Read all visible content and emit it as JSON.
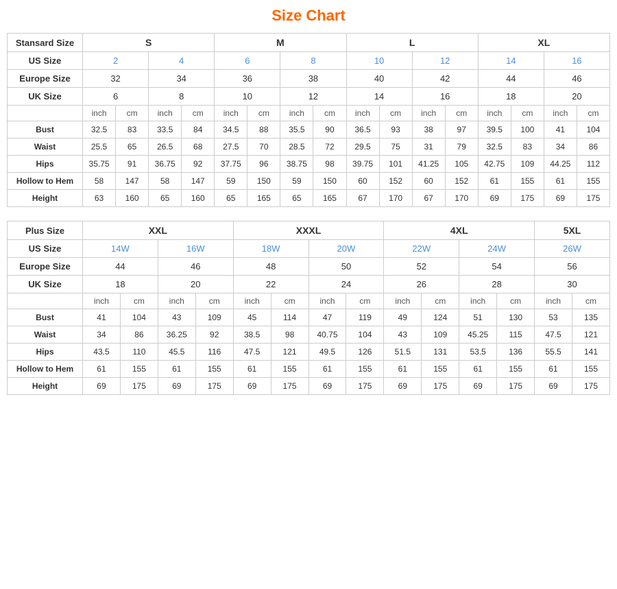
{
  "title": "Size Chart",
  "standard": {
    "header_label": "Stansard Size",
    "size_groups": [
      {
        "label": "S",
        "colspan": 4
      },
      {
        "label": "M",
        "colspan": 4
      },
      {
        "label": "L",
        "colspan": 4
      },
      {
        "label": "XL",
        "colspan": 4
      }
    ],
    "us_size_label": "US Size",
    "us_sizes": [
      "2",
      "4",
      "6",
      "8",
      "10",
      "12",
      "14",
      "16"
    ],
    "europe_size_label": "Europe Size",
    "europe_sizes": [
      "32",
      "34",
      "36",
      "38",
      "40",
      "42",
      "44",
      "46"
    ],
    "uk_size_label": "UK Size",
    "uk_sizes": [
      "6",
      "8",
      "10",
      "12",
      "14",
      "16",
      "18",
      "20"
    ],
    "unit_header": [
      "inch",
      "cm",
      "inch",
      "cm",
      "inch",
      "cm",
      "inch",
      "cm",
      "inch",
      "cm",
      "inch",
      "cm",
      "inch",
      "cm",
      "inch",
      "cm"
    ],
    "rows": [
      {
        "label": "Bust",
        "values": [
          "32.5",
          "83",
          "33.5",
          "84",
          "34.5",
          "88",
          "35.5",
          "90",
          "36.5",
          "93",
          "38",
          "97",
          "39.5",
          "100",
          "41",
          "104"
        ]
      },
      {
        "label": "Waist",
        "values": [
          "25.5",
          "65",
          "26.5",
          "68",
          "27.5",
          "70",
          "28.5",
          "72",
          "29.5",
          "75",
          "31",
          "79",
          "32.5",
          "83",
          "34",
          "86"
        ]
      },
      {
        "label": "Hips",
        "values": [
          "35.75",
          "91",
          "36.75",
          "92",
          "37.75",
          "96",
          "38.75",
          "98",
          "39.75",
          "101",
          "41.25",
          "105",
          "42.75",
          "109",
          "44.25",
          "112"
        ]
      },
      {
        "label": "Hollow to Hem",
        "values": [
          "58",
          "147",
          "58",
          "147",
          "59",
          "150",
          "59",
          "150",
          "60",
          "152",
          "60",
          "152",
          "61",
          "155",
          "61",
          "155"
        ]
      },
      {
        "label": "Height",
        "values": [
          "63",
          "160",
          "65",
          "160",
          "65",
          "165",
          "65",
          "165",
          "67",
          "170",
          "67",
          "170",
          "69",
          "175",
          "69",
          "175"
        ]
      }
    ]
  },
  "plus": {
    "header_label": "Plus Size",
    "size_groups": [
      {
        "label": "XXL",
        "colspan": 4
      },
      {
        "label": "XXXL",
        "colspan": 4
      },
      {
        "label": "4XL",
        "colspan": 4
      },
      {
        "label": "5XL",
        "colspan": 2
      }
    ],
    "us_size_label": "US Size",
    "us_sizes": [
      "14W",
      "16W",
      "18W",
      "20W",
      "22W",
      "24W",
      "26W"
    ],
    "europe_size_label": "Europe Size",
    "europe_sizes": [
      "44",
      "46",
      "48",
      "50",
      "52",
      "54",
      "56"
    ],
    "uk_size_label": "UK Size",
    "uk_sizes": [
      "18",
      "20",
      "22",
      "24",
      "26",
      "28",
      "30"
    ],
    "unit_header": [
      "inch",
      "cm",
      "inch",
      "cm",
      "inch",
      "cm",
      "inch",
      "cm",
      "inch",
      "cm",
      "inch",
      "cm",
      "inch",
      "cm"
    ],
    "rows": [
      {
        "label": "Bust",
        "values": [
          "41",
          "104",
          "43",
          "109",
          "45",
          "114",
          "47",
          "119",
          "49",
          "124",
          "51",
          "130",
          "53",
          "135"
        ]
      },
      {
        "label": "Waist",
        "values": [
          "34",
          "86",
          "36.25",
          "92",
          "38.5",
          "98",
          "40.75",
          "104",
          "43",
          "109",
          "45.25",
          "115",
          "47.5",
          "121"
        ]
      },
      {
        "label": "Hips",
        "values": [
          "43.5",
          "110",
          "45.5",
          "116",
          "47.5",
          "121",
          "49.5",
          "126",
          "51.5",
          "131",
          "53.5",
          "136",
          "55.5",
          "141"
        ]
      },
      {
        "label": "Hollow to Hem",
        "values": [
          "61",
          "155",
          "61",
          "155",
          "61",
          "155",
          "61",
          "155",
          "61",
          "155",
          "61",
          "155",
          "61",
          "155"
        ]
      },
      {
        "label": "Height",
        "values": [
          "69",
          "175",
          "69",
          "175",
          "69",
          "175",
          "69",
          "175",
          "69",
          "175",
          "69",
          "175",
          "69",
          "175"
        ]
      }
    ]
  }
}
